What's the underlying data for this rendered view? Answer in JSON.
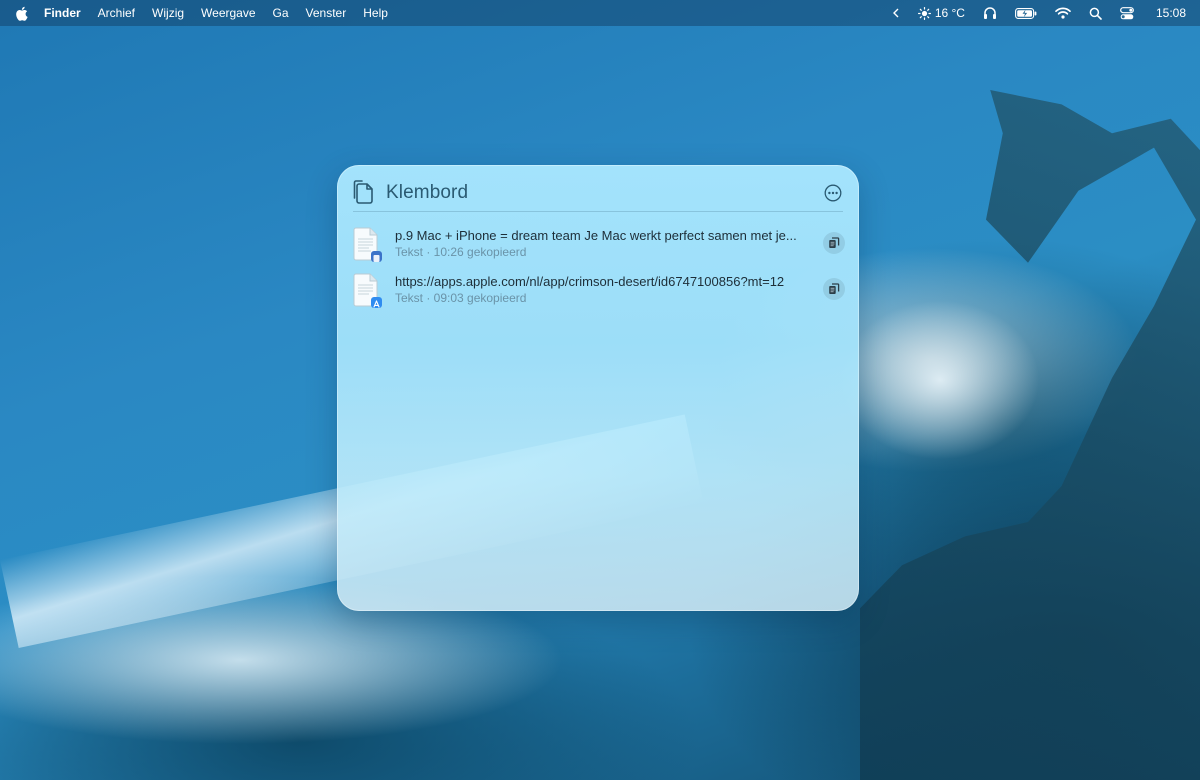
{
  "menubar": {
    "apple_icon": "apple-logo-icon",
    "app_name": "Finder",
    "menus": [
      "Archief",
      "Wijzig",
      "Weergave",
      "Ga",
      "Venster",
      "Help"
    ],
    "status": {
      "weather_temp": "16 °C",
      "clock": "15:08"
    }
  },
  "clipboard": {
    "title": "Klembord",
    "items": [
      {
        "title": "p.9 Mac + iPhone = dream team Je Mac werkt perfect samen met je...",
        "meta": "Tekst · 10:26 gekopieerd",
        "source_icon": "document-icon"
      },
      {
        "title": "https://apps.apple.com/nl/app/crimson-desert/id6747100856?mt=12",
        "meta": "Tekst · 09:03 gekopieerd",
        "source_icon": "app-store-icon"
      }
    ]
  },
  "colors": {
    "menubar_text": "#ffffff",
    "panel_title": "#2a5a72",
    "item_title": "#1d2e38",
    "item_meta": "#6a93a8"
  }
}
